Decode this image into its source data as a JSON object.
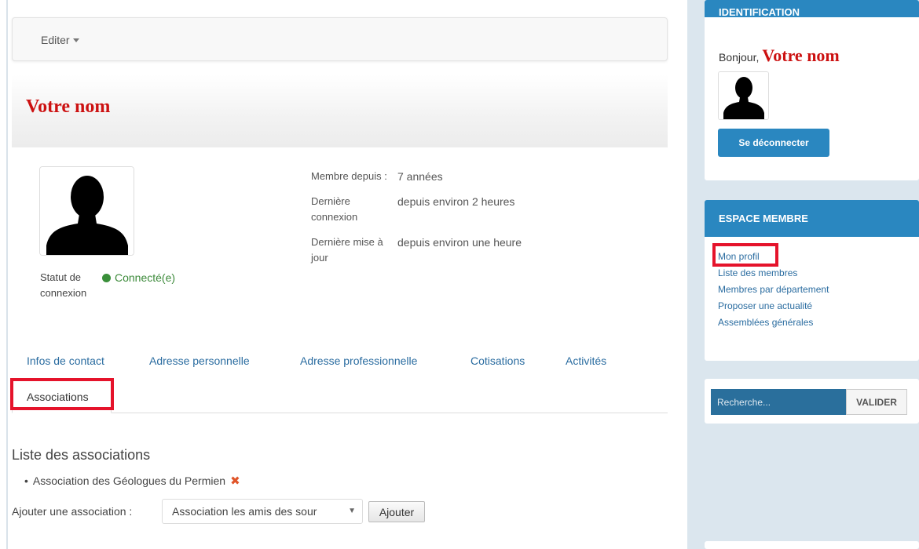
{
  "toolbar": {
    "edit_label": "Editer"
  },
  "profile": {
    "name": "Votre nom",
    "status_label": "Statut de connexion",
    "status_value": "Connecté(e)",
    "info": [
      {
        "key": "Membre depuis :",
        "value": "7 années"
      },
      {
        "key": "Dernière connexion",
        "value": "depuis environ 2 heures"
      },
      {
        "key": "Dernière mise à jour",
        "value": "depuis environ une heure"
      }
    ]
  },
  "tabs": [
    "Infos de contact",
    "Adresse personnelle",
    "Adresse professionnelle",
    "Cotisations",
    "Activités",
    "Associations"
  ],
  "associations": {
    "title": "Liste des associations",
    "items": [
      "Association des Géologues du Permien"
    ],
    "add_label": "Ajouter une association :",
    "select_value": "Association les amis des sour",
    "add_button": "Ajouter"
  },
  "sidebar": {
    "identification": {
      "header": "IDENTIFICATION",
      "greeting": "Bonjour,",
      "name": "Votre nom",
      "logout": "Se déconnecter"
    },
    "member_space": {
      "header": "ESPACE MEMBRE",
      "links": [
        "Mon profil",
        "Liste des membres",
        "Membres par département",
        "Proposer une actualité",
        "Assemblées générales"
      ]
    },
    "search": {
      "placeholder": "Recherche...",
      "button": "VALIDER"
    }
  },
  "colors": {
    "accent": "#2a87c0",
    "link": "#2a6ca0",
    "name_red": "#cc1111",
    "highlight": "#e5132b",
    "online": "#3a8f3a"
  }
}
